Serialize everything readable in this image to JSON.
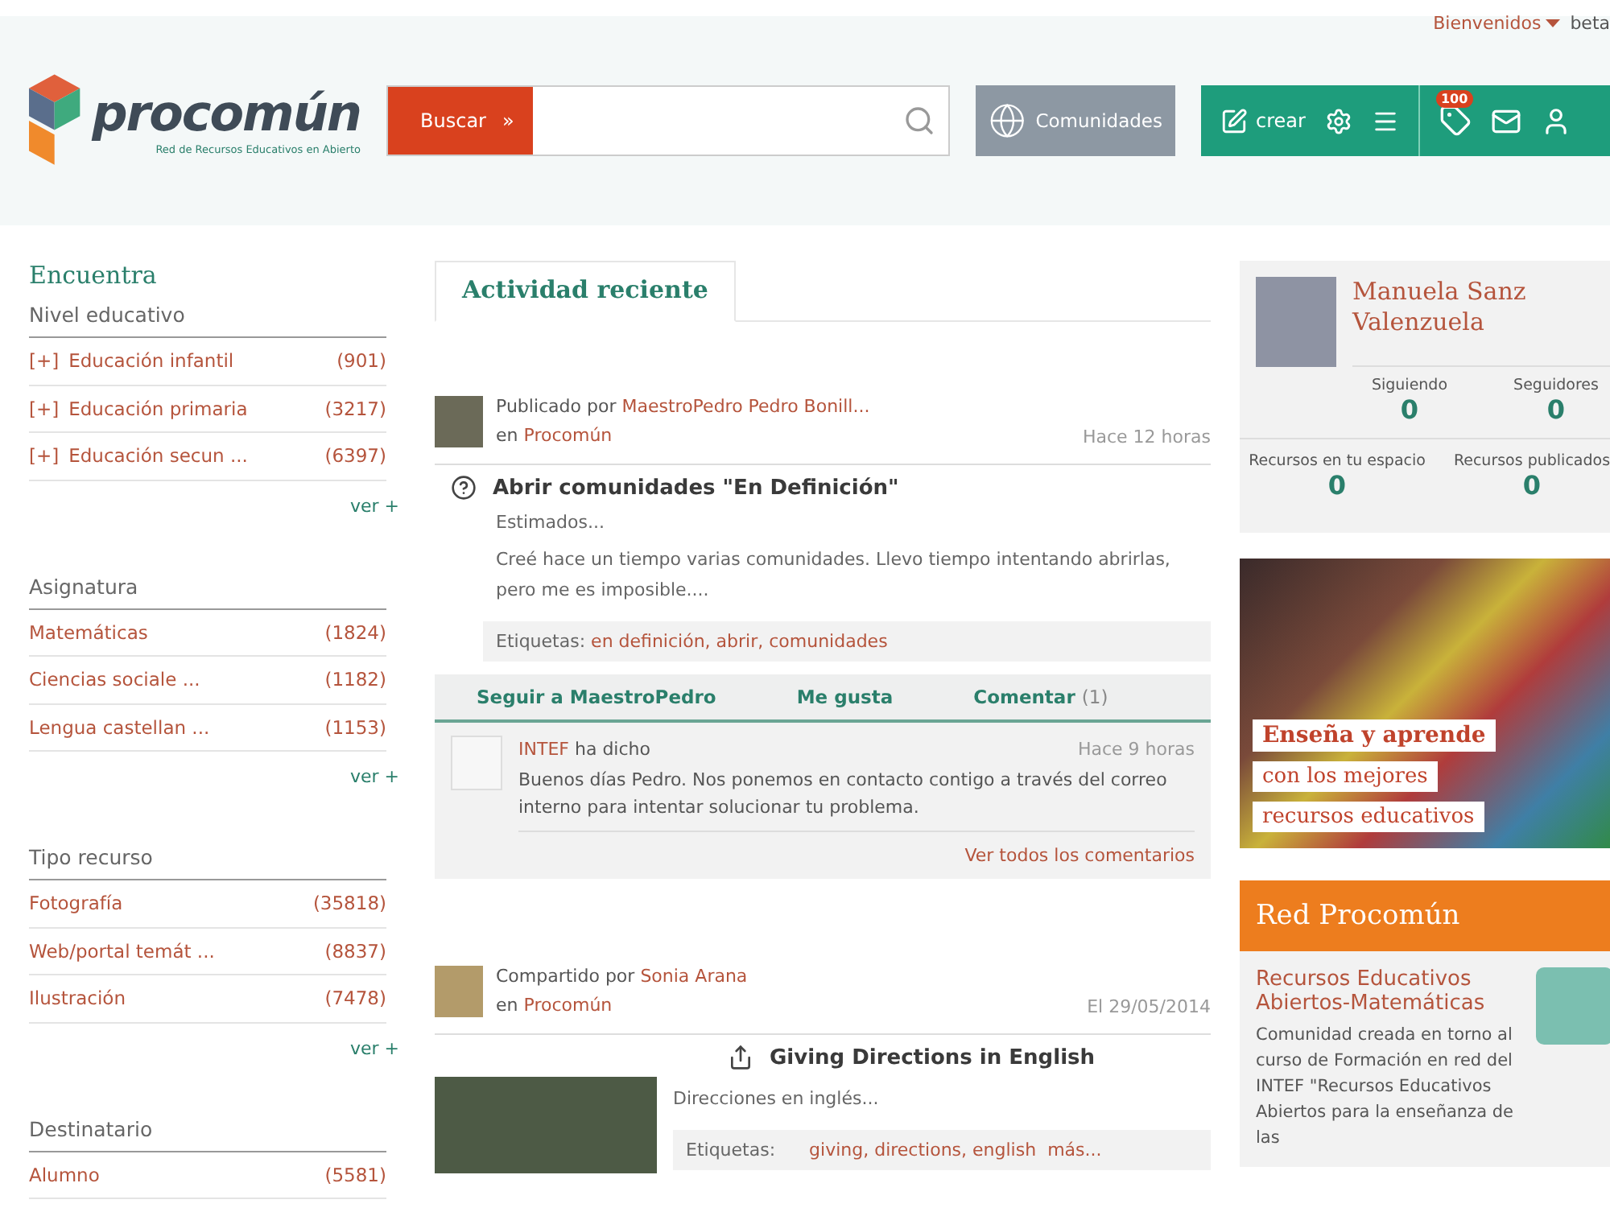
{
  "header": {
    "logo": {
      "name": "procomún",
      "subtitle": "Red de Recursos Educativos en Abierto"
    },
    "welcome": "Bienvenidos",
    "beta": "beta",
    "search": {
      "button": "Buscar",
      "arrow": "»"
    },
    "communities": "Comunidades",
    "create": "crear",
    "badge": "100"
  },
  "sidebar": {
    "title": "Encuentra",
    "sections": [
      {
        "title": "Nivel educativo",
        "items": [
          {
            "prefix": "[+]",
            "label": "Educación infantil",
            "count": "(901)"
          },
          {
            "prefix": "[+]",
            "label": "Educación primaria",
            "count": "(3217)"
          },
          {
            "prefix": "[+]",
            "label": "Educación secun ...",
            "count": "(6397)"
          }
        ],
        "more": "ver +"
      },
      {
        "title": "Asignatura",
        "items": [
          {
            "label": "Matemáticas",
            "count": "(1824)"
          },
          {
            "label": "Ciencias sociale ...",
            "count": "(1182)"
          },
          {
            "label": "Lengua castellan ...",
            "count": "(1153)"
          }
        ],
        "more": "ver +"
      },
      {
        "title": "Tipo recurso",
        "items": [
          {
            "label": "Fotografía",
            "count": "(35818)"
          },
          {
            "label": "Web/portal temát ...",
            "count": "(8837)"
          },
          {
            "label": "Ilustración",
            "count": "(7478)"
          }
        ],
        "more": "ver +"
      },
      {
        "title": "Destinatario",
        "items": [
          {
            "label": "Alumno",
            "count": "(5581)"
          }
        ]
      }
    ]
  },
  "tabs": [
    {
      "label": "Actividad reciente",
      "selected": true
    }
  ],
  "posts": [
    {
      "kind": "question",
      "verb": "Publicado por",
      "author": "MaestroPedro Pedro Bonill...",
      "in": "en",
      "place": "Procomún",
      "time": "Hace 12 horas",
      "title": "Abrir comunidades \"En Definición\"",
      "excerpt": "Estimados...",
      "body": "Creé hace un tiempo varias comunidades. Llevo tiempo intentando abrirlas, pero me es imposible....",
      "tags_label": "Etiquetas:",
      "tags": "en definición, abrir, comunidades",
      "actions": [
        {
          "label": "Seguir a MaestroPedro"
        },
        {
          "label": "Me gusta"
        },
        {
          "label": "Comentar",
          "count": "(1)"
        }
      ],
      "comments": [
        {
          "author": "INTEF",
          "verb": "ha dicho",
          "time": "Hace 9 horas",
          "text": "Buenos días Pedro. Nos ponemos en contacto contigo a través del correo interno para intentar solucionar tu problema."
        }
      ],
      "all_comments": "Ver todos los comentarios"
    },
    {
      "kind": "shared",
      "verb": "Compartido por",
      "author": "Sonia Arana",
      "in": "en",
      "place": "Procomún",
      "time": "El 29/05/2014",
      "title": "Giving Directions in English",
      "excerpt": "Direcciones en inglés...",
      "tags_label": "Etiquetas:",
      "tags": "giving, directions, english",
      "tags_more": "más..."
    }
  ],
  "profile": {
    "name": "Manuela Sanz Valenzuela",
    "stats": [
      {
        "label": "Siguiendo",
        "value": "0"
      },
      {
        "label": "Seguidores",
        "value": "0"
      },
      {
        "label": "Recursos en tu espacio",
        "value": "0"
      },
      {
        "label": "Recursos publicados",
        "value": "0"
      }
    ]
  },
  "banner": {
    "lines": [
      "Enseña y aprende",
      "con los mejores",
      "recursos educativos"
    ]
  },
  "network": {
    "title": "Red Procomún",
    "community": {
      "title": "Recursos Educativos Abiertos-Matemáticas",
      "description": "Comunidad creada en torno al curso de Formación en red del INTEF \"Recursos Educativos Abiertos para la enseñanza de las"
    }
  }
}
